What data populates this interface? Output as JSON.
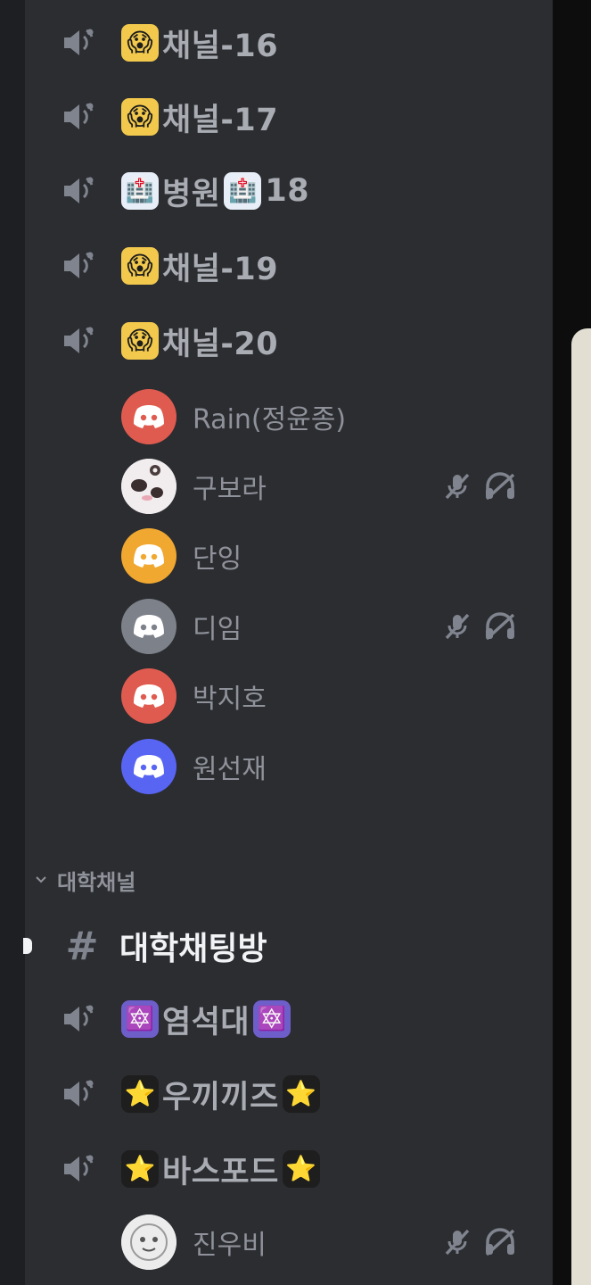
{
  "voice_channels_top": [
    {
      "emoji": "😱",
      "emoji_kind": "face",
      "name": "채널-16"
    },
    {
      "emoji": "😱",
      "emoji_kind": "face",
      "name": "채널-17"
    },
    {
      "emoji": "🏥",
      "emoji_kind": "hospital",
      "name": "병원",
      "trailing_emoji": "🏥",
      "suffix": "18"
    },
    {
      "emoji": "😱",
      "emoji_kind": "face",
      "name": "채널-19"
    },
    {
      "emoji": "😱",
      "emoji_kind": "face",
      "name": "채널-20"
    }
  ],
  "voice_members": [
    {
      "name": "Rain(정윤종)",
      "avatar_color": "#e05b4f",
      "muted": false
    },
    {
      "name": "구보라",
      "avatar_color": "#f1ecee",
      "muted": true
    },
    {
      "name": "단잉",
      "avatar_color": "#f0a830",
      "muted": false
    },
    {
      "name": "디임",
      "avatar_color": "#7d818a",
      "muted": true
    },
    {
      "name": "박지호",
      "avatar_color": "#e05b4f",
      "muted": false
    },
    {
      "name": "원선재",
      "avatar_color": "#5865f2",
      "muted": false
    }
  ],
  "category": {
    "label": "대학채널"
  },
  "text_channel": {
    "name": "대학채팅방"
  },
  "voice_channels_bottom": [
    {
      "emoji": "🔯",
      "emoji_kind": "hexagram",
      "name": "염석대",
      "trailing_emoji": "🔯"
    },
    {
      "emoji": "⭐",
      "emoji_kind": "star",
      "name": "우끼끼즈",
      "trailing_emoji": "⭐"
    },
    {
      "emoji": "⭐",
      "emoji_kind": "star",
      "name": "바스포드",
      "trailing_emoji": "⭐"
    }
  ],
  "bottom_member": {
    "name": "진우비",
    "avatar_color": "#e9e9e9",
    "muted": true
  },
  "icons": {
    "voice": "speaker-icon",
    "mute": "microphone-muted-icon",
    "deafen": "headphones-deafened-icon",
    "discord": "discord-logo-icon",
    "text": "hash-icon",
    "collapse": "chevron-down-icon"
  },
  "colors": {
    "sidebar_bg": "#2b2d31",
    "rail_bg": "#1e1f22",
    "channel_text": "#a9acb3",
    "member_text": "#8f929a",
    "active_text": "#f2f3f5"
  }
}
